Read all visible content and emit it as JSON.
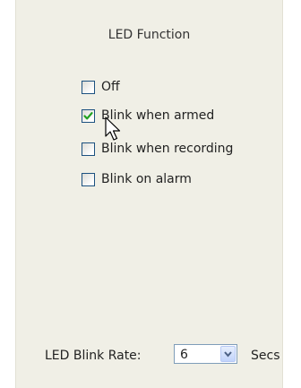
{
  "title": "LED Function",
  "options": [
    {
      "label": "Off",
      "checked": false
    },
    {
      "label": "Blink when armed",
      "checked": true
    },
    {
      "label": "Blink when recording",
      "checked": false
    },
    {
      "label": "Blink on alarm",
      "checked": false
    }
  ],
  "blink_rate": {
    "label": "LED Blink Rate:",
    "value": "6",
    "unit": "Secs"
  },
  "colors": {
    "panel_background": "#f0efe6",
    "checkbox_border": "#1c5180",
    "checkmark": "#21a121"
  }
}
